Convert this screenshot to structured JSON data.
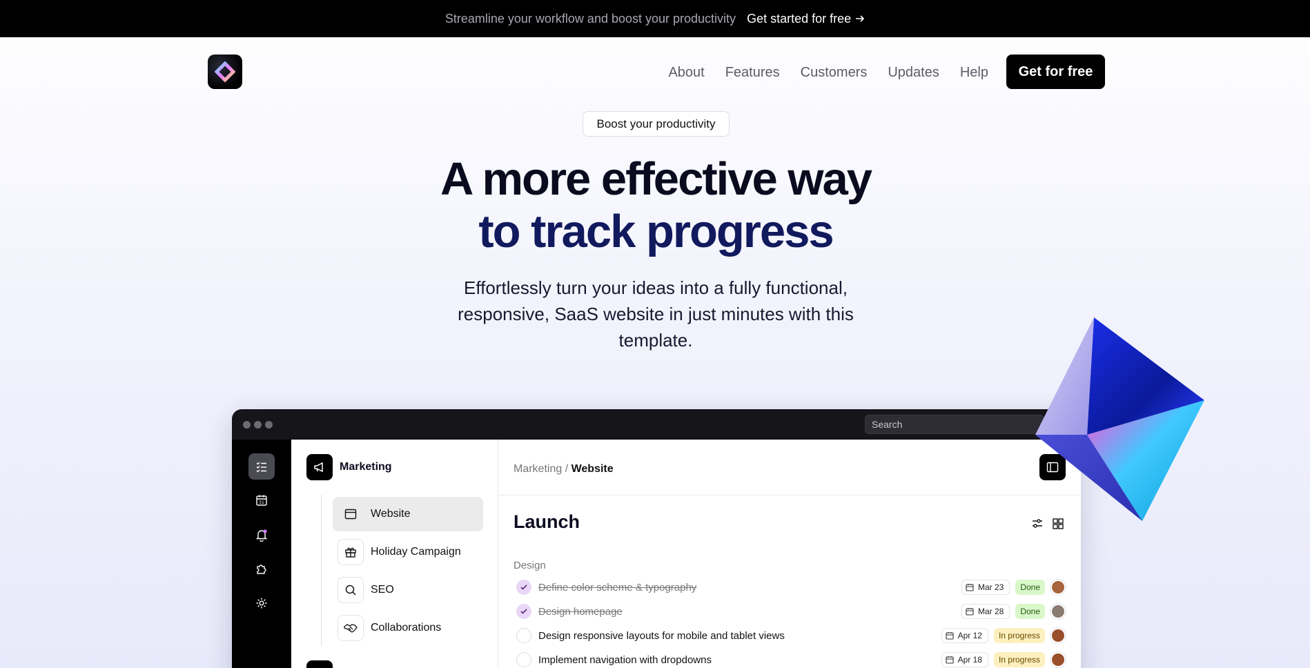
{
  "announcement": {
    "message": "Streamline your workflow and boost your productivity",
    "cta": "Get started for free"
  },
  "nav": {
    "items": [
      "About",
      "Features",
      "Customers",
      "Updates",
      "Help"
    ],
    "cta": "Get for free"
  },
  "hero": {
    "pill": "Boost your productivity",
    "title_line1": "A more effective way",
    "title_line2": "to track progress",
    "subtitle": "Effortlessly turn your ideas into a fully functional, responsive, SaaS website in just minutes with this template."
  },
  "app": {
    "search_placeholder": "Search",
    "project": "Marketing",
    "subprojects": [
      "Website",
      "Holiday Campaign",
      "SEO",
      "Collaborations"
    ],
    "breadcrumb_parent": "Marketing",
    "breadcrumb_sep": " / ",
    "breadcrumb_current": "Website",
    "section_title": "Launch",
    "group_label": "Design",
    "tasks": [
      {
        "title": "Define color scheme & typography",
        "date": "Mar 23",
        "status": "Done",
        "done": true
      },
      {
        "title": "Design homepage",
        "date": "Mar 28",
        "status": "Done",
        "done": true
      },
      {
        "title": "Design responsive layouts for mobile and tablet views",
        "date": "Apr 12",
        "status": "In progress",
        "done": false
      },
      {
        "title": "Implement navigation with dropdowns",
        "date": "Apr 18",
        "status": "In progress",
        "done": false
      }
    ]
  },
  "colors": {
    "accent_dark": "#121a5e",
    "done_badge": "#d9f7c9",
    "progress_badge": "#fdf0bf",
    "check_done": "#ead7f7"
  }
}
